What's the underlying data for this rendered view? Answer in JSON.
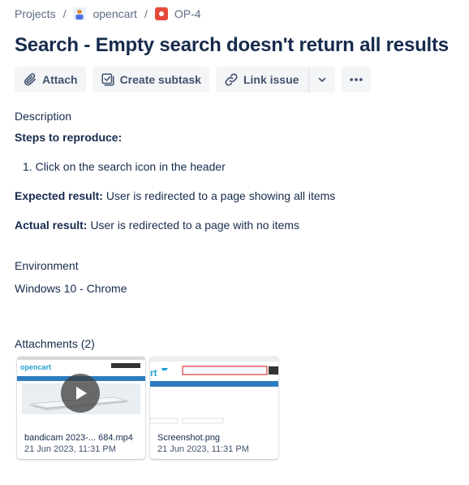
{
  "breadcrumb": {
    "projects": "Projects",
    "project": "opencart",
    "issue_key": "OP-4",
    "separator": "/"
  },
  "title": "Search - Empty search doesn't return all results",
  "toolbar": {
    "attach": "Attach",
    "create_subtask": "Create subtask",
    "link_issue": "Link issue"
  },
  "description": {
    "label": "Description",
    "steps_heading": "Steps to reproduce:",
    "steps": [
      "Click on the search icon in the header"
    ],
    "step_number": "1.",
    "expected_label": "Expected result:",
    "expected_text": " User is redirected to a page showing all items",
    "actual_label": "Actual result:",
    "actual_text": " User is redirected to a page with no items"
  },
  "environment": {
    "label": "Environment",
    "value": "Windows 10 - Chrome"
  },
  "attachments": {
    "label": "Attachments (2)",
    "items": [
      {
        "name": "bandicam 2023-... 684.mp4",
        "date": "21 Jun 2023, 11:31 PM",
        "type": "video"
      },
      {
        "name": "Screenshot.png",
        "date": "21 Jun 2023, 11:31 PM",
        "type": "image"
      }
    ]
  },
  "colors": {
    "text": "#172b4d",
    "muted": "#5e6c84",
    "button_bg": "#f4f5f7",
    "bug_red": "#e5493a"
  }
}
